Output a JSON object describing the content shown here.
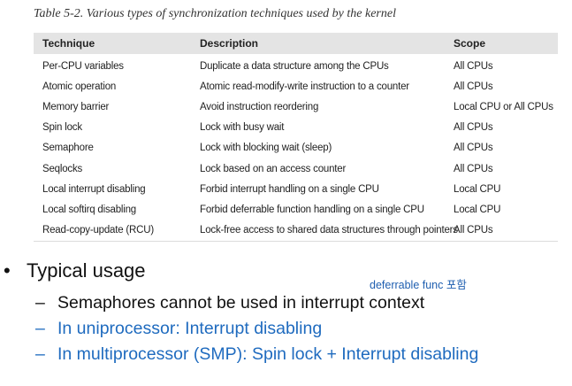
{
  "caption": "Table 5-2. Various types of synchronization techniques used by the kernel",
  "table": {
    "headers": [
      "Technique",
      "Description",
      "Scope"
    ],
    "rows": [
      [
        "Per-CPU variables",
        "Duplicate a data structure among the CPUs",
        "All CPUs"
      ],
      [
        "Atomic operation",
        "Atomic read-modify-write instruction to a counter",
        "All CPUs"
      ],
      [
        "Memory barrier",
        "Avoid instruction reordering",
        "Local CPU or All CPUs"
      ],
      [
        "Spin lock",
        "Lock with busy wait",
        "All CPUs"
      ],
      [
        "Semaphore",
        "Lock with blocking wait (sleep)",
        "All CPUs"
      ],
      [
        "Seqlocks",
        "Lock based on an access counter",
        "All CPUs"
      ],
      [
        "Local interrupt disabling",
        "Forbid interrupt handling on a single CPU",
        "Local CPU"
      ],
      [
        "Local softirq disabling",
        "Forbid deferrable function handling on a single CPU",
        "Local CPU"
      ],
      [
        "Read-copy-update (RCU)",
        "Lock-free access to shared data structures through pointers",
        "All CPUs"
      ]
    ]
  },
  "bullet": {
    "marker": "•",
    "text": "Typical usage"
  },
  "note": "deferrable func 포함",
  "subitems": {
    "marker": "–",
    "items": [
      "Semaphores cannot be used in interrupt context",
      "In uniprocessor: Interrupt disabling",
      "In multiprocessor (SMP): Spin lock + Interrupt disabling"
    ]
  },
  "colors": {
    "accent_blue": "#1f6bbf",
    "header_bg": "#e4e4e4"
  }
}
